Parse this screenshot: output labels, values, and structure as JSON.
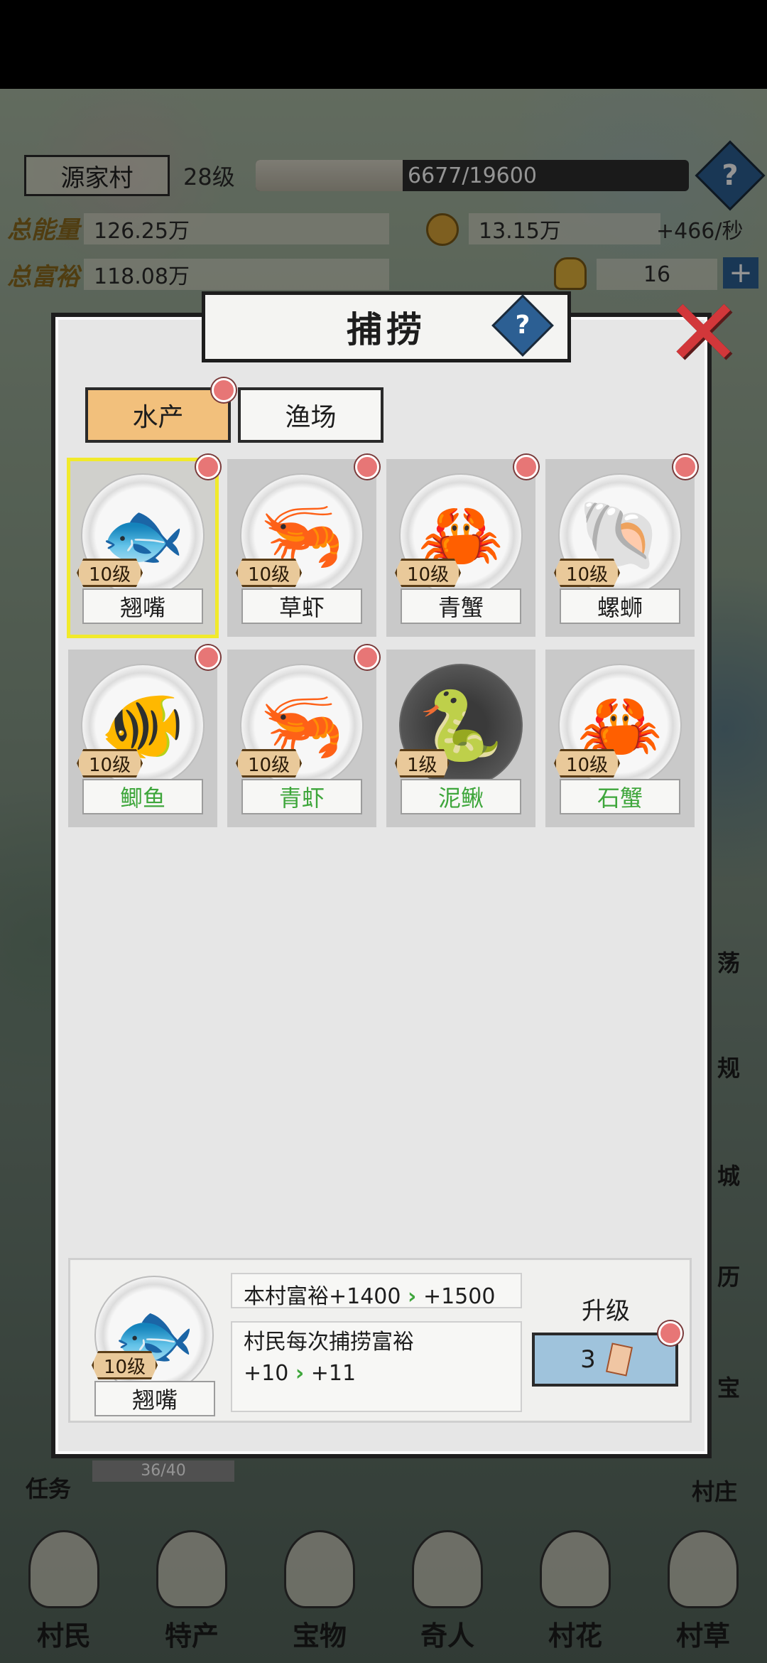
{
  "hud": {
    "village_name": "源家村",
    "village_level": "28级",
    "exp_text": "6677/19600",
    "exp_fraction": 0.34,
    "power_label": "总能量",
    "power_value": "126.25万",
    "wealth_label": "总富裕",
    "wealth_value": "118.08万",
    "coin_value": "13.15万",
    "coin_rate": "+466/秒",
    "gold_value": "16",
    "help_icon": "?",
    "plus_icon": "+"
  },
  "dialog": {
    "title": "捕捞",
    "close_icon": "✕",
    "tabs": [
      {
        "label": "水产",
        "active": true
      },
      {
        "label": "渔场",
        "active": false
      }
    ],
    "items": [
      {
        "name": "翘嘴",
        "level": "10级",
        "icon": "fish-icon",
        "glyph": "🐟",
        "owned_style": "normal",
        "dot": true,
        "selected": true
      },
      {
        "name": "草虾",
        "level": "10级",
        "icon": "shrimp-icon",
        "glyph": "🦐",
        "owned_style": "normal",
        "dot": true
      },
      {
        "name": "青蟹",
        "level": "10级",
        "icon": "crab-icon",
        "glyph": "🦀",
        "owned_style": "normal",
        "dot": true
      },
      {
        "name": "螺蛳",
        "level": "10级",
        "icon": "snail-icon",
        "glyph": "🐚",
        "owned_style": "normal",
        "dot": true
      },
      {
        "name": "鲫鱼",
        "level": "10级",
        "icon": "fish-icon",
        "glyph": "🐠",
        "owned_style": "green",
        "dot": true
      },
      {
        "name": "青虾",
        "level": "10级",
        "icon": "shrimp-icon",
        "glyph": "🦐",
        "owned_style": "green",
        "dot": true
      },
      {
        "name": "泥鳅",
        "level": "1级",
        "icon": "loach-icon",
        "glyph": "🐍",
        "owned_style": "green",
        "dot": false,
        "dark": true
      },
      {
        "name": "石蟹",
        "level": "10级",
        "icon": "crab-icon",
        "glyph": "🦀",
        "owned_style": "green",
        "dot": false
      }
    ]
  },
  "detail": {
    "name": "翘嘴",
    "level": "10级",
    "glyph": "🐟",
    "wealth_line_prefix": "本村富裕+1400",
    "wealth_line_suffix": "+1500",
    "catch_line_1": "村民每次捕捞富裕",
    "catch_line_2_prefix": "+10",
    "catch_line_2_suffix": "+11",
    "arrow": "›",
    "upgrade_label": "升级",
    "upgrade_cost": "3"
  },
  "side": {
    "left_task": "任务",
    "task_progress": "36/40",
    "right_labels": [
      "荡",
      "规",
      "城",
      "历",
      "宝",
      "村庄"
    ]
  },
  "nav": [
    "村民",
    "特产",
    "宝物",
    "奇人",
    "村花",
    "村草"
  ],
  "colors": {
    "accent_tab": "#f2c07c",
    "green_text": "#3ea63b",
    "red_dot": "#e77676",
    "close_red": "#d2373a",
    "help_blue": "#2c5f93"
  }
}
